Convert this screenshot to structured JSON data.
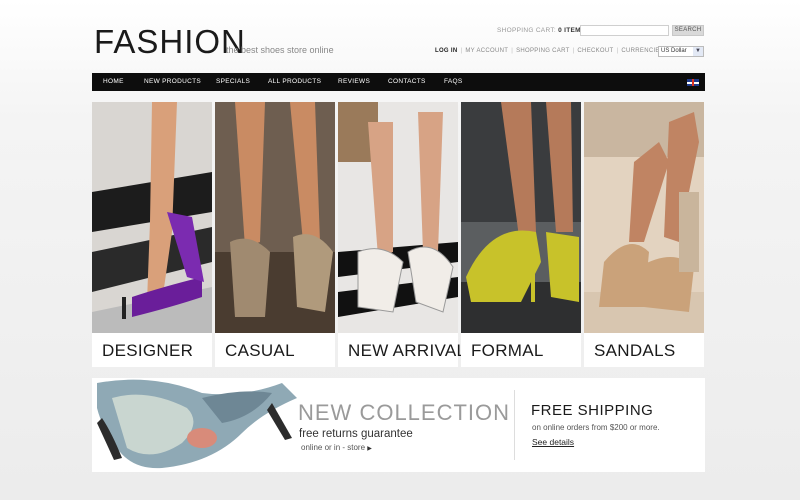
{
  "header": {
    "logo": "FASHION",
    "tagline": "the best shoes store online",
    "cart_label": "SHOPPING CART:",
    "cart_count": "0 ITEMS",
    "search_button": "SEARCH",
    "currency_label": "CURRENCIES:",
    "currency_value": "US Dollar",
    "links": [
      "LOG IN",
      "MY ACCOUNT",
      "SHOPPING CART",
      "CHECKOUT"
    ]
  },
  "nav": {
    "items": [
      "HOME",
      "NEW PRODUCTS",
      "SPECIALS",
      "ALL PRODUCTS",
      "REVIEWS",
      "CONTACTS",
      "FAQS"
    ]
  },
  "categories": [
    {
      "label": "DESIGNER"
    },
    {
      "label": "CASUAL"
    },
    {
      "label": "NEW ARRIVAL"
    },
    {
      "label": "FORMAL"
    },
    {
      "label": "SANDALS"
    }
  ],
  "banner": {
    "title": "NEW COLLECTION",
    "subtitle": "free returns guarantee",
    "online": "online or in - store",
    "shipping_title": "FREE SHIPPING",
    "shipping_text": "on online orders from $200 or more.",
    "details_link": "See details"
  },
  "colors": {
    "nav_bg": "#0d0d0d",
    "accent_purple": "#6a1e9a",
    "accent_yellow": "#c8c22a"
  }
}
